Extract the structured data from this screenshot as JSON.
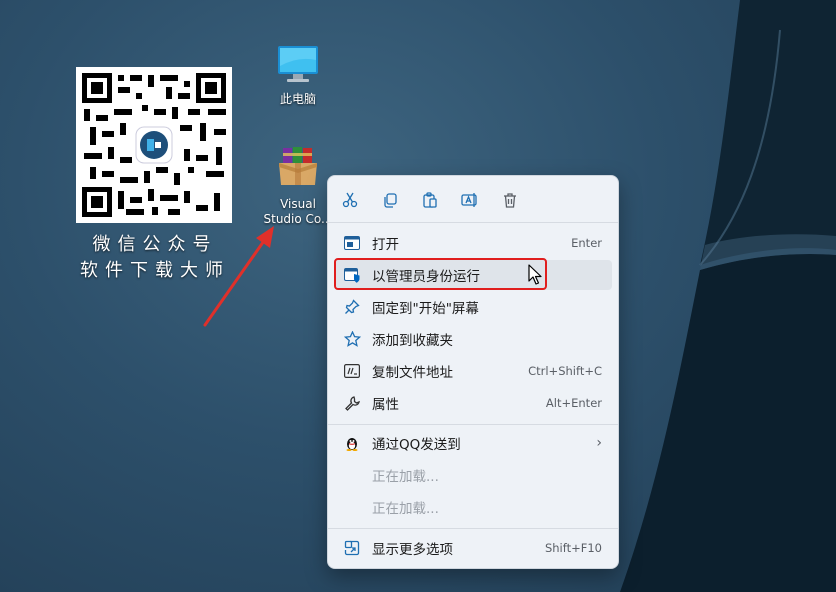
{
  "qr": {
    "caption_line1": "微信公众号",
    "caption_line2": "软件下载大师"
  },
  "desktop_icons": [
    {
      "label": "此电脑",
      "icon": "monitor-icon"
    },
    {
      "label_line1": "Visual",
      "label_line2": "Studio Co...",
      "icon": "winrar-archive-icon"
    }
  ],
  "toolbar": [
    "cut-icon",
    "copy-icon",
    "paste-icon",
    "rename-icon",
    "delete-icon"
  ],
  "menu": {
    "open": {
      "label": "打开",
      "shortcut": "Enter"
    },
    "run_as_admin": {
      "label": "以管理员身份运行"
    },
    "pin_start": {
      "label": "固定到\"开始\"屏幕"
    },
    "add_favorites": {
      "label": "添加到收藏夹"
    },
    "copy_path": {
      "label": "复制文件地址",
      "shortcut": "Ctrl+Shift+C"
    },
    "properties": {
      "label": "属性",
      "shortcut": "Alt+Enter"
    },
    "send_qq": {
      "label": "通过QQ发送到"
    },
    "loading1": {
      "label": "正在加载..."
    },
    "loading2": {
      "label": "正在加载..."
    },
    "more_options": {
      "label": "显示更多选项",
      "shortcut": "Shift+F10"
    }
  },
  "colors": {
    "highlight": "#e01e1e",
    "accent": "#0067c0",
    "arrow": "#e0302a"
  }
}
